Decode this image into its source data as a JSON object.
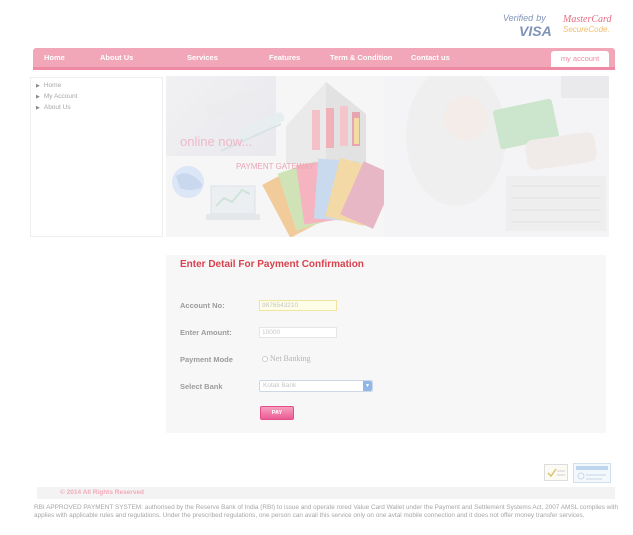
{
  "header": {
    "verified_by": "Verified",
    "verified_by_suffix": "by",
    "visa": "VISA",
    "mastercard": "MasterCard",
    "securecode": "SecureCode."
  },
  "nav": {
    "items": [
      {
        "label": "Home"
      },
      {
        "label": "About Us"
      },
      {
        "label": "Services"
      },
      {
        "label": "Features"
      },
      {
        "label": "Term & Condition"
      },
      {
        "label": "Contact us"
      }
    ],
    "account_tab": "my account"
  },
  "side_menu": {
    "items": [
      {
        "label": "Home"
      },
      {
        "label": "My Account"
      },
      {
        "label": "About Us"
      }
    ]
  },
  "banner": {
    "tagline": "online now...",
    "gateway_label": "PAYMENT GATEWAY"
  },
  "form": {
    "title": "Enter Detail For Payment Confirmation",
    "account_label": "Account No:",
    "account_value": "9876543210",
    "amount_label": "Enter Amount:",
    "amount_value": "10000",
    "mode_label": "Payment Mode",
    "mode_option": "Net Banking",
    "bank_label": "Select Bank",
    "bank_value": "Kotak Bank",
    "submit_label": "PAY"
  },
  "footer": {
    "copyright": "© 2014 All Rights Reserved",
    "disclaimer": "RBI APPROVED PAYMENT SYSTEM: authorised by the Reserve Bank of India (RBI) to issue and operate rored Value Card Wallet under the Payment and Settlement Systems Act, 2007 AMSL complies with applies with applicable rules and regulations. Under the prescribed regulations, one person can avail this service only on one avtal mobile connection and it does not offer money transfer services."
  },
  "colors": {
    "nav_bg": "#f2a7b8",
    "title_red": "#d8424e",
    "button_pink": "#ec5b94"
  }
}
